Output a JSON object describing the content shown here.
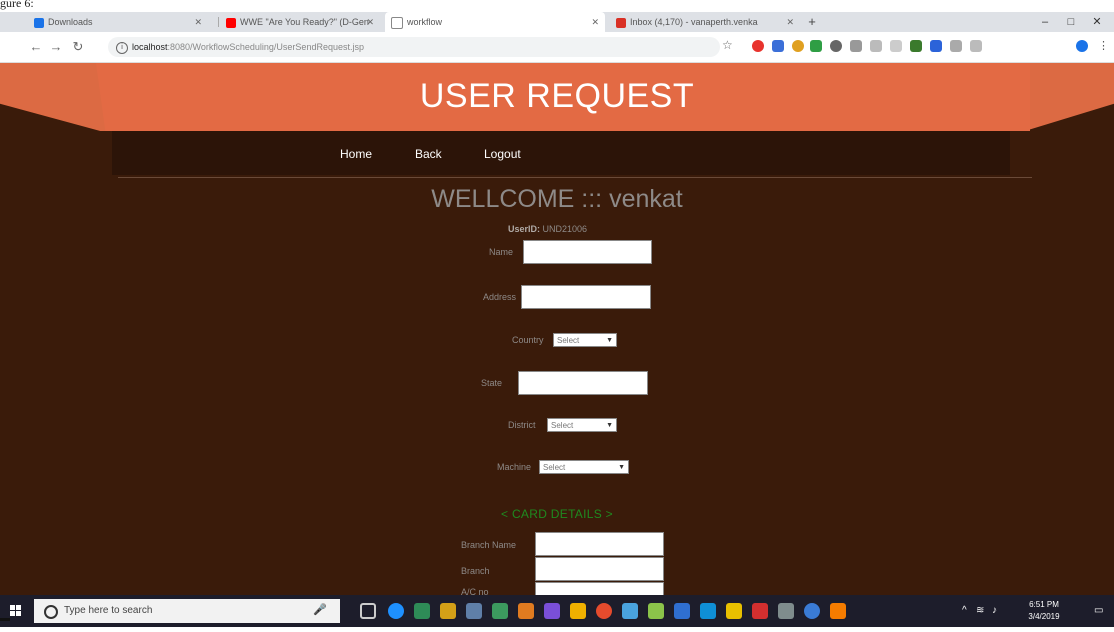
{
  "caption": "gure 6:",
  "browser": {
    "tabs": [
      {
        "label": "Downloads",
        "icon": "download-icon",
        "color": "#1a73e8"
      },
      {
        "label": "WWE \"Are You Ready?\" (D-Gen",
        "icon": "youtube-icon",
        "color": "#ff0000"
      },
      {
        "label": "workflow",
        "icon": "page-icon",
        "color": "#888888"
      },
      {
        "label": "Inbox (4,170) - vanaperth.venka",
        "icon": "gmail-icon",
        "color": "#d93025"
      }
    ],
    "new_tab": "+",
    "url_host": "localhost",
    "url_path": ":8080/WorkflowScheduling/UserSendRequest.jsp",
    "window_controls": [
      "–",
      "□",
      "✕"
    ]
  },
  "page": {
    "banner_title": "USER REQUEST",
    "nav": [
      "Home",
      "Back",
      "Logout"
    ],
    "welcome": "WELLCOME ::: venkat",
    "user_id_label": "UserID:",
    "user_id_value": "UND21006",
    "fields": {
      "name": "Name",
      "address": "Address",
      "country": "Country",
      "state": "State",
      "district": "District",
      "machine": "Machine",
      "select_placeholder": "Select"
    },
    "card_details": "< CARD DETAILS >",
    "card_fields": {
      "branch_name": "Branch Name",
      "branch": "Branch",
      "ac_no": "A/C no"
    }
  },
  "taskbar": {
    "search_placeholder": "Type here to search",
    "time": "6:51 PM",
    "date": "3/4/2019"
  },
  "colors": {
    "banner": "#e36a44",
    "page_bg": "#3a1b0a",
    "card_details": "#1f8a1f"
  }
}
